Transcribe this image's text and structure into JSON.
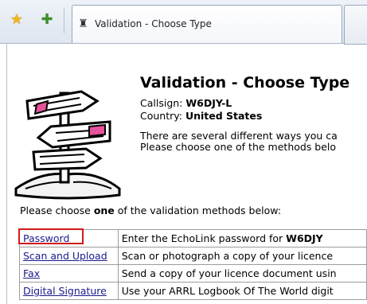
{
  "browser": {
    "tab_title": "Validation - Choose Type",
    "icons": {
      "favorites": "star-icon",
      "add_favorite": "add-favorite-icon",
      "tab": "tower-icon"
    }
  },
  "page": {
    "title": "Validation - Choose Type",
    "callsign_label": "Callsign: ",
    "callsign": "W6DJY-L",
    "country_label": "Country: ",
    "country": "United States",
    "description_line1": "There are several different ways you ca",
    "description_line2": "Please choose one of the methods belo",
    "prompt_before": "Please choose ",
    "prompt_emph": "one",
    "prompt_after": " of the validation methods below:"
  },
  "methods": [
    {
      "name": "Password",
      "description": "Enter the EchoLink password for",
      "description_emph": "W6DJY",
      "highlighted": true
    },
    {
      "name": "Scan and Upload",
      "description": "Scan or photograph a copy of your licence"
    },
    {
      "name": "Fax",
      "description": "Send a copy of your licence document usin"
    },
    {
      "name": "Digital Signature",
      "description": "Use your ARRL Logbook Of The World digit"
    }
  ],
  "colors": {
    "highlight": "#d01919",
    "link": "#1a1a8c"
  }
}
